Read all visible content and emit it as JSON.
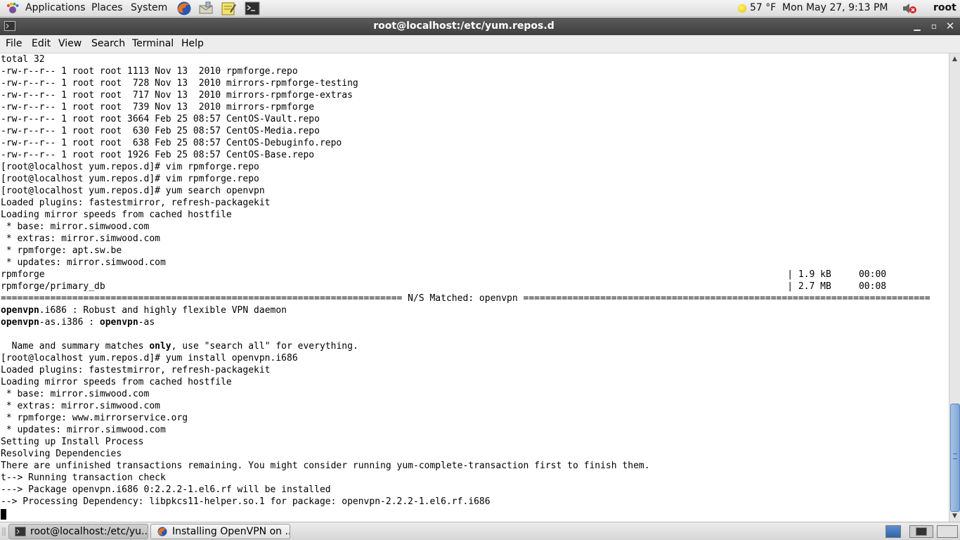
{
  "top_panel": {
    "menus": [
      "Applications",
      "Places",
      "System"
    ],
    "launchers": [
      "firefox-icon",
      "mail-client-icon",
      "text-editor-icon",
      "terminal-icon"
    ],
    "weather": "57 °F",
    "datetime": "Mon May 27,  9:13 PM",
    "user": "root"
  },
  "window": {
    "title": "root@localhost:/etc/yum.repos.d",
    "menu": [
      "File",
      "Edit",
      "View",
      "Search",
      "Terminal",
      "Help"
    ]
  },
  "terminal": {
    "lines": [
      "total 32",
      "-rw-r--r-- 1 root root 1113 Nov 13  2010 rpmforge.repo",
      "-rw-r--r-- 1 root root  728 Nov 13  2010 mirrors-rpmforge-testing",
      "-rw-r--r-- 1 root root  717 Nov 13  2010 mirrors-rpmforge-extras",
      "-rw-r--r-- 1 root root  739 Nov 13  2010 mirrors-rpmforge",
      "-rw-r--r-- 1 root root 3664 Feb 25 08:57 CentOS-Vault.repo",
      "-rw-r--r-- 1 root root  630 Feb 25 08:57 CentOS-Media.repo",
      "-rw-r--r-- 1 root root  638 Feb 25 08:57 CentOS-Debuginfo.repo",
      "-rw-r--r-- 1 root root 1926 Feb 25 08:57 CentOS-Base.repo",
      "[root@localhost yum.repos.d]# vim rpmforge.repo",
      "[root@localhost yum.repos.d]# vim rpmforge.repo",
      "[root@localhost yum.repos.d]# yum search openvpn",
      "Loaded plugins: fastestmirror, refresh-packagekit",
      "Loading mirror speeds from cached hostfile",
      " * base: mirror.simwood.com",
      " * extras: mirror.simwood.com",
      " * rpmforge: apt.sw.be",
      " * updates: mirror.simwood.com",
      "rpmforge                                                                                                                                       | 1.9 kB     00:00",
      "rpmforge/primary_db                                                                                                                            | 2.7 MB     00:08",
      "========================================================================= N/S Matched: openvpn ==========================================================================",
      [
        {
          "t": "openvpn",
          "b": true
        },
        {
          "t": ".i686 : Robust and highly flexible VPN daemon"
        }
      ],
      [
        {
          "t": "openvpn",
          "b": true
        },
        {
          "t": "-as.i386 : "
        },
        {
          "t": "openvpn",
          "b": true
        },
        {
          "t": "-as"
        }
      ],
      "",
      [
        {
          "t": "  Name and summary matches "
        },
        {
          "t": "only",
          "b": true
        },
        {
          "t": ", use \"search all\" for everything."
        }
      ],
      "[root@localhost yum.repos.d]# yum install openvpn.i686",
      "Loaded plugins: fastestmirror, refresh-packagekit",
      "Loading mirror speeds from cached hostfile",
      " * base: mirror.simwood.com",
      " * extras: mirror.simwood.com",
      " * rpmforge: www.mirrorservice.org",
      " * updates: mirror.simwood.com",
      "Setting up Install Process",
      "Resolving Dependencies",
      "There are unfinished transactions remaining. You might consider running yum-complete-transaction first to finish them.",
      "t--> Running transaction check",
      "---> Package openvpn.i686 0:2.2.2-1.el6.rf will be installed",
      "--> Processing Dependency: libpkcs11-helper.so.1 for package: openvpn-2.2.2-1.el6.rf.i686"
    ]
  },
  "taskbar": {
    "items": [
      {
        "label": "root@localhost:/etc/yu...",
        "icon": "terminal-icon",
        "active": true
      },
      {
        "label": "Installing OpenVPN on ...",
        "icon": "firefox-icon",
        "active": false
      }
    ]
  },
  "colors": {
    "titlebar": "#4a4a4a",
    "terminal_bg": "#ffffff",
    "scroll_thumb": "#8fb2dd"
  }
}
